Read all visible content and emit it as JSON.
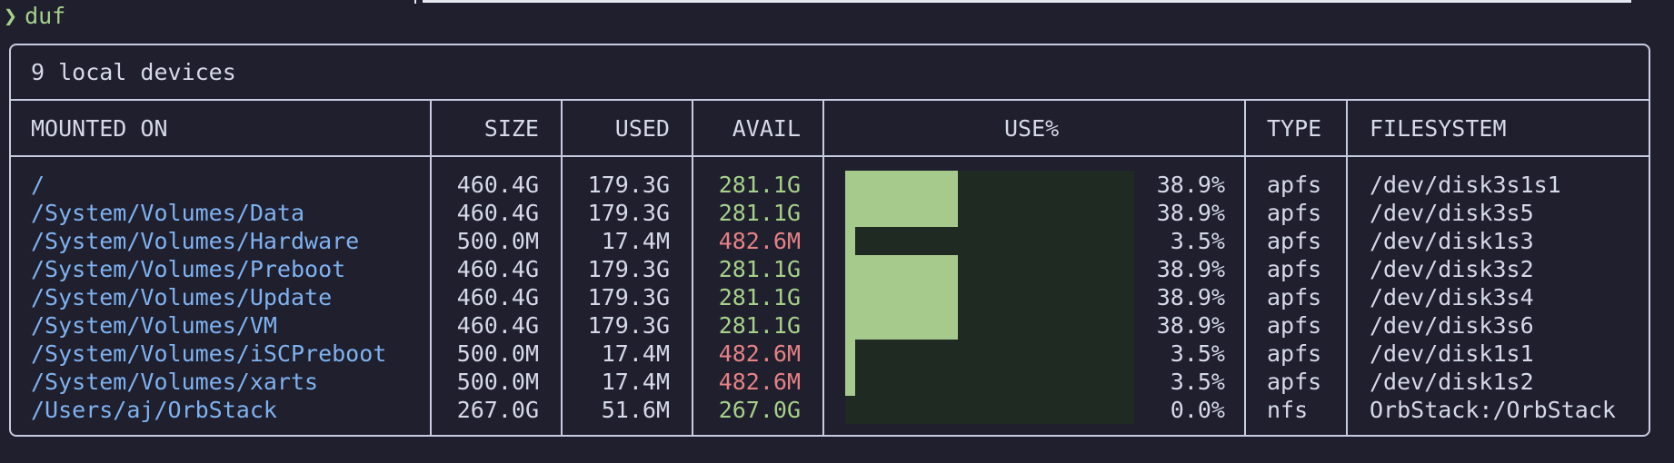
{
  "prompt": {
    "symbol": "❯",
    "command": "duf"
  },
  "table": {
    "title": "9 local devices",
    "headers": {
      "mounted_on": "MOUNTED ON",
      "size": "SIZE",
      "used": "USED",
      "avail": "AVAIL",
      "use_pct": "USE%",
      "type": "TYPE",
      "filesystem": "FILESYSTEM"
    },
    "rows": [
      {
        "mount": "/",
        "size": "460.4G",
        "used": "179.3G",
        "avail": "281.1G",
        "avail_status": "ok",
        "use_pct": "38.9%",
        "use_fraction": 0.389,
        "type": "apfs",
        "filesystem": "/dev/disk3s1s1"
      },
      {
        "mount": "/System/Volumes/Data",
        "size": "460.4G",
        "used": "179.3G",
        "avail": "281.1G",
        "avail_status": "ok",
        "use_pct": "38.9%",
        "use_fraction": 0.389,
        "type": "apfs",
        "filesystem": "/dev/disk3s5"
      },
      {
        "mount": "/System/Volumes/Hardware",
        "size": "500.0M",
        "used": "17.4M",
        "avail": "482.6M",
        "avail_status": "bad",
        "use_pct": "3.5%",
        "use_fraction": 0.035,
        "type": "apfs",
        "filesystem": "/dev/disk1s3"
      },
      {
        "mount": "/System/Volumes/Preboot",
        "size": "460.4G",
        "used": "179.3G",
        "avail": "281.1G",
        "avail_status": "ok",
        "use_pct": "38.9%",
        "use_fraction": 0.389,
        "type": "apfs",
        "filesystem": "/dev/disk3s2"
      },
      {
        "mount": "/System/Volumes/Update",
        "size": "460.4G",
        "used": "179.3G",
        "avail": "281.1G",
        "avail_status": "ok",
        "use_pct": "38.9%",
        "use_fraction": 0.389,
        "type": "apfs",
        "filesystem": "/dev/disk3s4"
      },
      {
        "mount": "/System/Volumes/VM",
        "size": "460.4G",
        "used": "179.3G",
        "avail": "281.1G",
        "avail_status": "ok",
        "use_pct": "38.9%",
        "use_fraction": 0.389,
        "type": "apfs",
        "filesystem": "/dev/disk3s6"
      },
      {
        "mount": "/System/Volumes/iSCPreboot",
        "size": "500.0M",
        "used": "17.4M",
        "avail": "482.6M",
        "avail_status": "bad",
        "use_pct": "3.5%",
        "use_fraction": 0.035,
        "type": "apfs",
        "filesystem": "/dev/disk1s1"
      },
      {
        "mount": "/System/Volumes/xarts",
        "size": "500.0M",
        "used": "17.4M",
        "avail": "482.6M",
        "avail_status": "bad",
        "use_pct": "3.5%",
        "use_fraction": 0.035,
        "type": "apfs",
        "filesystem": "/dev/disk1s2"
      },
      {
        "mount": "/Users/aj/OrbStack",
        "size": "267.0G",
        "used": "51.6M",
        "avail": "267.0G",
        "avail_status": "ok",
        "use_pct": "0.0%",
        "use_fraction": 0.0,
        "type": "nfs",
        "filesystem": "OrbStack:/OrbStack"
      }
    ]
  },
  "colors": {
    "background": "#1f1f2e",
    "mount_path": "#7fb2f0",
    "avail_ok": "#a6d189",
    "avail_low": "#e78284",
    "bar_fill": "#a6c98c",
    "bar_track": "#1e2a22"
  }
}
